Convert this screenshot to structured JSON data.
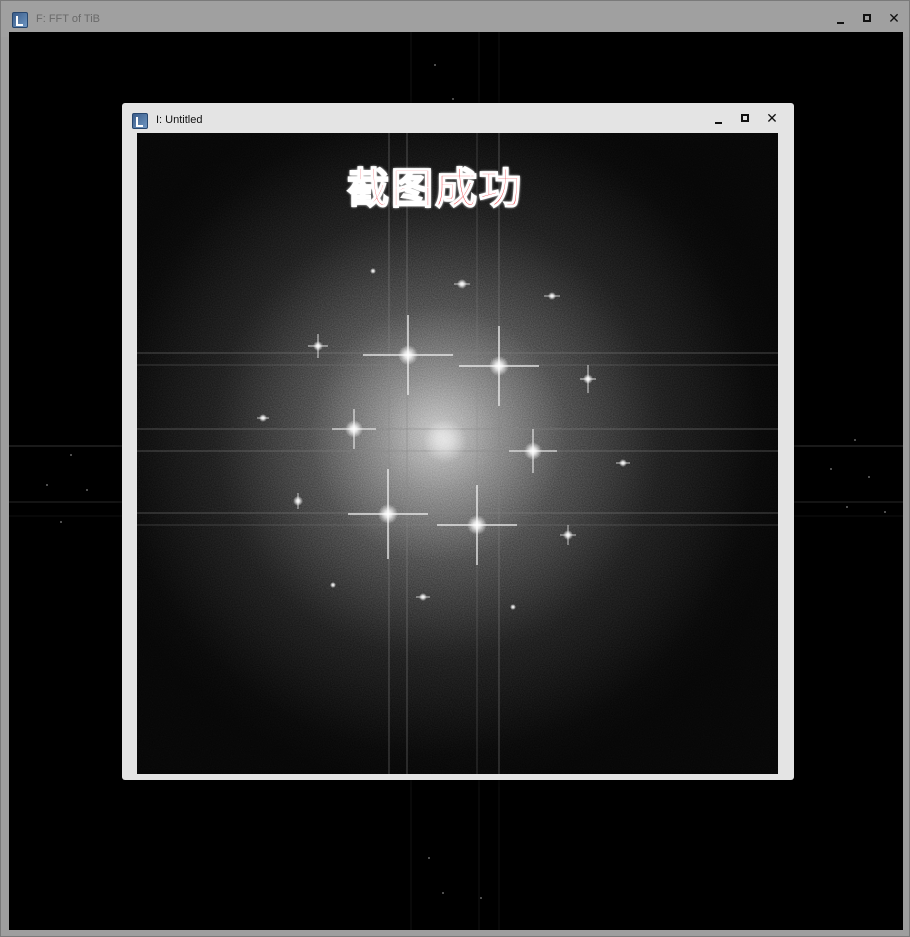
{
  "outer_window": {
    "title": "F: FFT of TiB"
  },
  "inner_window": {
    "title": "I: Untitled",
    "overlay_text": "截图成功"
  },
  "icons": {
    "app": "imagej-icon",
    "minimize": "minimize-icon",
    "maximize": "maximize-icon",
    "close": "close-icon"
  }
}
